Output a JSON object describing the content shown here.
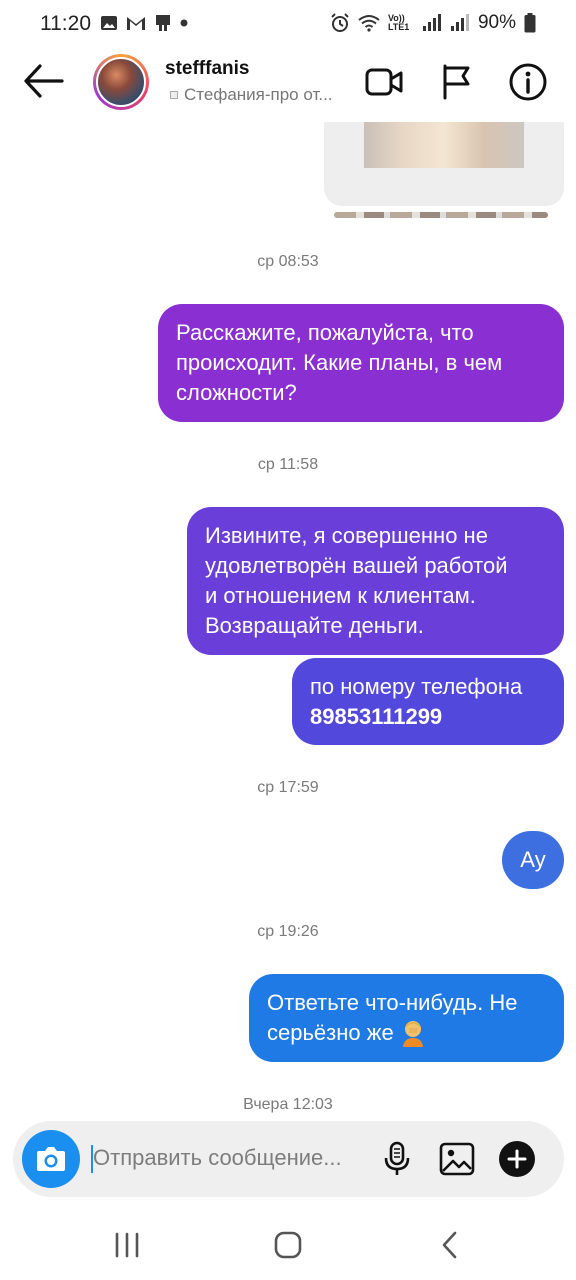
{
  "status_bar": {
    "time": "11:20",
    "lte_label": "Vo)) LTE1",
    "battery": "90%"
  },
  "header": {
    "username": "stefffanis",
    "subtitle": "Стефания-про от..."
  },
  "messages": [
    {
      "type": "timestamp",
      "text": "ср 08:53"
    },
    {
      "type": "sent",
      "lines": [
        "Расскажите, пожалуйста, что",
        "происходит. Какие планы, в чем",
        "сложности?"
      ]
    },
    {
      "type": "timestamp",
      "text": "ср 11:58"
    },
    {
      "type": "sent",
      "lines": [
        "Извините, я совершенно не",
        "удовлетворён вашей работой",
        "и отношением к клиентам.",
        "Возвращайте деньги."
      ]
    },
    {
      "type": "sent",
      "line1": "по номеру телефона",
      "phone": "89853111299"
    },
    {
      "type": "timestamp",
      "text": "ср 17:59"
    },
    {
      "type": "sent",
      "text": "Ау"
    },
    {
      "type": "timestamp",
      "text": "ср 19:26"
    },
    {
      "type": "sent",
      "lines": [
        "Ответьте что-нибудь. Не",
        "серьёзно же"
      ]
    },
    {
      "type": "timestamp",
      "text": "Вчера 12:03"
    }
  ],
  "composer": {
    "placeholder": "Отправить сообщение..."
  },
  "colors": {
    "bubble_1": "#8a2fd1",
    "bubble_2": "#6a3ed9",
    "bubble_3": "#5348dc",
    "bubble_4": "#3d6fe0",
    "bubble_5": "#1f7ae6",
    "accent": "#1a8ff0"
  },
  "icons": {
    "header": [
      "back-arrow-icon",
      "video-call-icon",
      "flag-icon",
      "info-icon"
    ],
    "composer": [
      "camera-icon",
      "microphone-icon",
      "gallery-icon",
      "plus-icon"
    ],
    "navigation": [
      "recent-apps-icon",
      "home-icon",
      "back-icon"
    ]
  }
}
